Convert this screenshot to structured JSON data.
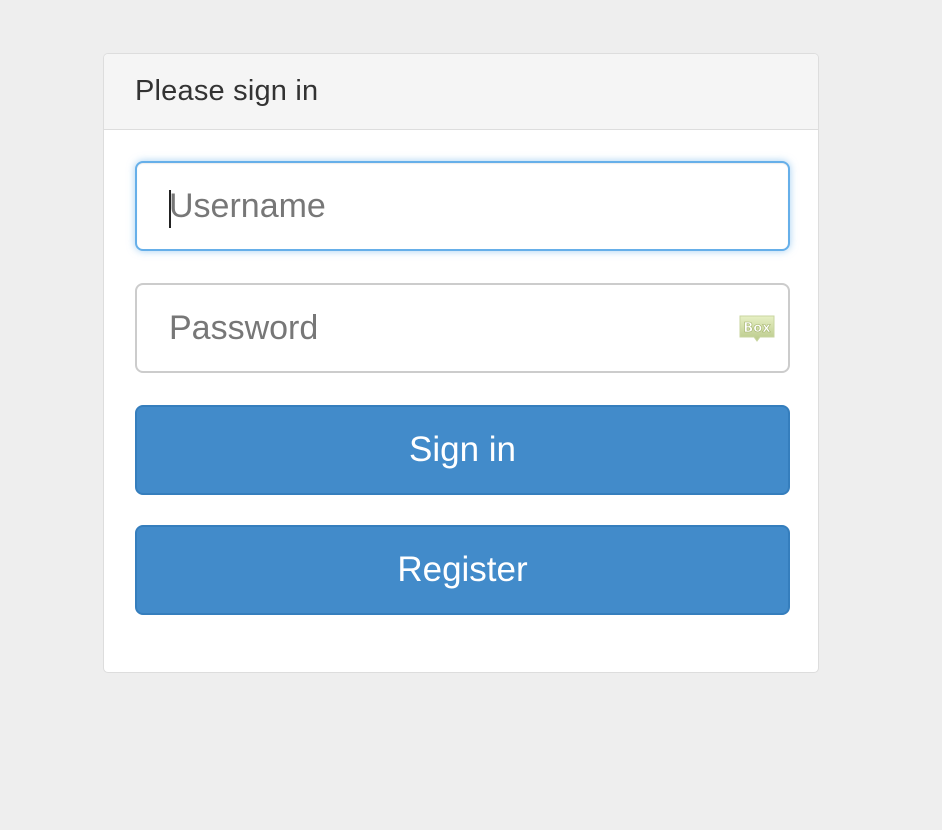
{
  "panel": {
    "title": "Please sign in"
  },
  "form": {
    "username": {
      "placeholder": "Username",
      "value": ""
    },
    "password": {
      "placeholder": "Password",
      "value": "",
      "extension_icon": "box-icon",
      "extension_icon_text": "Box"
    },
    "sign_in_label": "Sign in",
    "register_label": "Register"
  },
  "colors": {
    "page_background": "#eeeeee",
    "panel_heading": "#f5f5f5",
    "primary_button": "#428bca",
    "focus_border": "#66afe9"
  }
}
